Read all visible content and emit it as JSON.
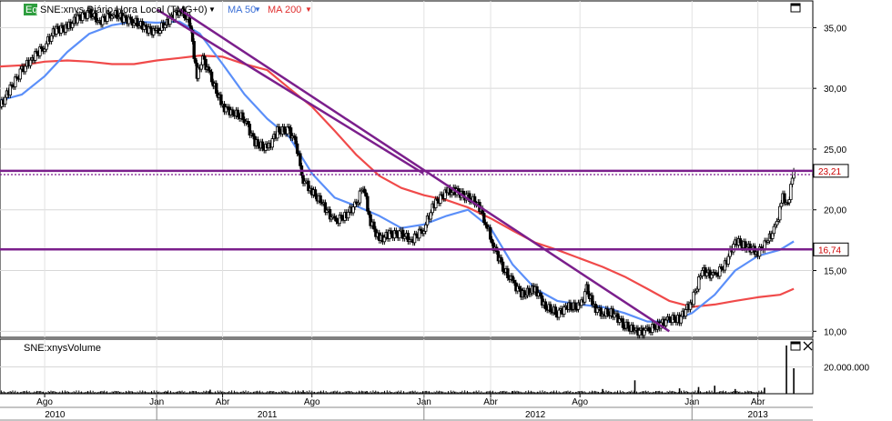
{
  "header": {
    "eq_badge": "Eq",
    "title": "SNE:xnys Diário Hora Local (TMG+0)",
    "ma50_label": "MA 50",
    "ma200_label": "MA 200"
  },
  "volume_panel": {
    "title": "SNE:xnysVolume"
  },
  "colors": {
    "price": "#000000",
    "ma50": "#5b8ff9",
    "ma200": "#f04a4a",
    "trendline": "#7b1f8c",
    "eq_badge": "#2e9e3e"
  },
  "icons": [
    "maximize-icon",
    "maximize-icon",
    "close-icon"
  ],
  "chart_data": [
    {
      "type": "line",
      "title": "SNE:xnys Diário Hora Local (TMG+0)",
      "ylim": [
        9.5,
        37.2
      ],
      "y_ticks": [
        "35,00",
        "30,00",
        "25,00",
        "20,00",
        "15,00",
        "10,00"
      ],
      "y_tick_values": [
        35,
        30,
        25,
        20,
        15,
        10
      ],
      "x_tick_labels": [
        "Ago",
        "Jan",
        "Abr",
        "Ago",
        "Jan",
        "Abr",
        "Ago",
        "Jan",
        "Abr"
      ],
      "x_tick_dates": [
        "2010-08-01",
        "2011-01-01",
        "2011-04-01",
        "2011-08-01",
        "2012-01-01",
        "2012-04-01",
        "2012-08-01",
        "2013-01-01",
        "2013-04-01"
      ],
      "year_labels": [
        "2010",
        "2011",
        "2012",
        "2013"
      ],
      "year_label_dates": [
        "2010-08-15",
        "2011-06-01",
        "2012-06-01",
        "2013-04-01"
      ],
      "year_boundaries": [
        "2011-01-01",
        "2012-01-01",
        "2013-01-01"
      ],
      "x_range": [
        "2010-06-01",
        "2013-06-15"
      ],
      "grid": true,
      "series": [
        {
          "name": "SNE:xnys",
          "points": [
            [
              "2010-06-01",
              28.5
            ],
            [
              "2010-06-15",
              30.0
            ],
            [
              "2010-07-01",
              31.5
            ],
            [
              "2010-07-15",
              32.5
            ],
            [
              "2010-08-01",
              33.5
            ],
            [
              "2010-08-15",
              34.8
            ],
            [
              "2010-09-01",
              35.0
            ],
            [
              "2010-09-15",
              35.8
            ],
            [
              "2010-10-01",
              36.2
            ],
            [
              "2010-10-15",
              35.5
            ],
            [
              "2010-11-01",
              36.2
            ],
            [
              "2010-11-15",
              35.8
            ],
            [
              "2010-12-01",
              35.5
            ],
            [
              "2010-12-15",
              35.0
            ],
            [
              "2011-01-01",
              34.6
            ],
            [
              "2011-01-15",
              35.5
            ],
            [
              "2011-02-01",
              36.5
            ],
            [
              "2011-02-15",
              35.5
            ],
            [
              "2011-02-25",
              31.0
            ],
            [
              "2011-03-05",
              32.5
            ],
            [
              "2011-03-15",
              31.0
            ],
            [
              "2011-04-01",
              28.5
            ],
            [
              "2011-04-15",
              28.0
            ],
            [
              "2011-05-01",
              27.5
            ],
            [
              "2011-05-15",
              25.5
            ],
            [
              "2011-06-01",
              25.0
            ],
            [
              "2011-06-15",
              26.5
            ],
            [
              "2011-07-01",
              26.5
            ],
            [
              "2011-07-10",
              25.5
            ],
            [
              "2011-07-20",
              22.5
            ],
            [
              "2011-08-01",
              21.5
            ],
            [
              "2011-08-15",
              20.5
            ],
            [
              "2011-09-01",
              19.0
            ],
            [
              "2011-09-15",
              19.5
            ],
            [
              "2011-10-01",
              20.5
            ],
            [
              "2011-10-10",
              22.0
            ],
            [
              "2011-10-20",
              19.0
            ],
            [
              "2011-11-01",
              17.5
            ],
            [
              "2011-11-15",
              18.0
            ],
            [
              "2011-12-01",
              18.0
            ],
            [
              "2011-12-15",
              17.5
            ],
            [
              "2012-01-01",
              18.5
            ],
            [
              "2012-01-15",
              20.5
            ],
            [
              "2012-02-01",
              21.5
            ],
            [
              "2012-02-15",
              21.5
            ],
            [
              "2012-03-01",
              21.0
            ],
            [
              "2012-03-15",
              20.5
            ],
            [
              "2012-03-25",
              19.0
            ],
            [
              "2012-04-05",
              17.0
            ],
            [
              "2012-04-20",
              15.0
            ],
            [
              "2012-05-01",
              14.0
            ],
            [
              "2012-05-15",
              13.0
            ],
            [
              "2012-06-01",
              13.5
            ],
            [
              "2012-06-15",
              12.0
            ],
            [
              "2012-07-01",
              11.5
            ],
            [
              "2012-07-15",
              12.0
            ],
            [
              "2012-08-01",
              12.0
            ],
            [
              "2012-08-10",
              13.5
            ],
            [
              "2012-08-20",
              12.0
            ],
            [
              "2012-09-01",
              11.5
            ],
            [
              "2012-09-15",
              11.5
            ],
            [
              "2012-10-01",
              10.5
            ],
            [
              "2012-10-15",
              10.0
            ],
            [
              "2012-11-01",
              10.0
            ],
            [
              "2012-11-15",
              10.5
            ],
            [
              "2012-12-01",
              11.0
            ],
            [
              "2012-12-15",
              11.0
            ],
            [
              "2013-01-01",
              12.5
            ],
            [
              "2013-01-15",
              15.0
            ],
            [
              "2013-02-01",
              14.5
            ],
            [
              "2013-02-15",
              15.5
            ],
            [
              "2013-03-01",
              17.5
            ],
            [
              "2013-03-15",
              17.0
            ],
            [
              "2013-04-01",
              16.5
            ],
            [
              "2013-04-15",
              17.5
            ],
            [
              "2013-04-25",
              18.5
            ],
            [
              "2013-05-05",
              21.0
            ],
            [
              "2013-05-12",
              20.5
            ],
            [
              "2013-05-20",
              23.2
            ]
          ]
        },
        {
          "name": "MA 50",
          "points": [
            [
              "2010-06-01",
              29.0
            ],
            [
              "2010-07-01",
              29.5
            ],
            [
              "2010-08-01",
              31.0
            ],
            [
              "2010-09-01",
              33.0
            ],
            [
              "2010-10-01",
              34.5
            ],
            [
              "2010-11-01",
              35.2
            ],
            [
              "2010-12-01",
              35.5
            ],
            [
              "2011-01-01",
              35.4
            ],
            [
              "2011-02-01",
              35.5
            ],
            [
              "2011-03-01",
              34.5
            ],
            [
              "2011-04-01",
              32.0
            ],
            [
              "2011-05-01",
              29.5
            ],
            [
              "2011-06-01",
              27.5
            ],
            [
              "2011-07-01",
              26.0
            ],
            [
              "2011-08-01",
              23.0
            ],
            [
              "2011-09-01",
              21.0
            ],
            [
              "2011-10-01",
              20.3
            ],
            [
              "2011-11-01",
              19.5
            ],
            [
              "2011-12-01",
              18.5
            ],
            [
              "2012-01-01",
              18.8
            ],
            [
              "2012-02-01",
              19.5
            ],
            [
              "2012-03-01",
              20.0
            ],
            [
              "2012-04-01",
              18.5
            ],
            [
              "2012-05-01",
              15.5
            ],
            [
              "2012-06-01",
              13.5
            ],
            [
              "2012-07-01",
              12.5
            ],
            [
              "2012-08-01",
              12.2
            ],
            [
              "2012-09-01",
              12.0
            ],
            [
              "2012-10-01",
              11.5
            ],
            [
              "2012-11-01",
              10.8
            ],
            [
              "2012-12-01",
              10.8
            ],
            [
              "2013-01-01",
              11.5
            ],
            [
              "2013-02-01",
              13.0
            ],
            [
              "2013-03-01",
              15.0
            ],
            [
              "2013-04-01",
              16.2
            ],
            [
              "2013-05-01",
              16.7
            ],
            [
              "2013-05-20",
              17.4
            ]
          ]
        },
        {
          "name": "MA 200",
          "points": [
            [
              "2010-06-01",
              31.8
            ],
            [
              "2010-07-01",
              31.9
            ],
            [
              "2010-08-01",
              32.2
            ],
            [
              "2010-09-01",
              32.3
            ],
            [
              "2010-10-01",
              32.2
            ],
            [
              "2010-11-01",
              32.0
            ],
            [
              "2010-12-01",
              32.0
            ],
            [
              "2011-01-01",
              32.3
            ],
            [
              "2011-02-01",
              32.5
            ],
            [
              "2011-03-01",
              32.7
            ],
            [
              "2011-04-01",
              32.6
            ],
            [
              "2011-05-01",
              32.0
            ],
            [
              "2011-06-01",
              31.5
            ],
            [
              "2011-07-01",
              30.0
            ],
            [
              "2011-08-01",
              28.5
            ],
            [
              "2011-09-01",
              26.5
            ],
            [
              "2011-10-01",
              24.5
            ],
            [
              "2011-11-01",
              22.8
            ],
            [
              "2011-12-01",
              21.8
            ],
            [
              "2012-01-01",
              21.2
            ],
            [
              "2012-02-01",
              20.8
            ],
            [
              "2012-03-01",
              20.2
            ],
            [
              "2012-04-01",
              19.3
            ],
            [
              "2012-05-01",
              18.3
            ],
            [
              "2012-06-01",
              17.3
            ],
            [
              "2012-07-01",
              16.7
            ],
            [
              "2012-08-01",
              16.0
            ],
            [
              "2012-09-01",
              15.3
            ],
            [
              "2012-10-01",
              14.5
            ],
            [
              "2012-11-01",
              13.5
            ],
            [
              "2012-12-01",
              12.5
            ],
            [
              "2013-01-01",
              12.0
            ],
            [
              "2013-02-01",
              12.2
            ],
            [
              "2013-03-01",
              12.5
            ],
            [
              "2013-04-01",
              12.8
            ],
            [
              "2013-05-01",
              13.0
            ],
            [
              "2013-05-20",
              13.5
            ]
          ]
        }
      ],
      "horizontal_lines": [
        {
          "value": 23.21,
          "label": "23,21"
        },
        {
          "value": 16.74,
          "label": "16,74"
        }
      ],
      "trendlines": [
        {
          "from": [
            "2011-02-01",
            36.5
          ],
          "to": [
            "2012-12-01",
            10.0
          ]
        },
        {
          "from": [
            "2011-01-01",
            36.5
          ],
          "to": [
            "2011-12-31",
            23.0
          ]
        }
      ],
      "dotted_line": {
        "value": 22.9
      }
    },
    {
      "type": "bar",
      "title": "SNE:xnysVolume",
      "y_ticks": [
        "20.000.000"
      ],
      "y_tick_values": [
        20000000
      ],
      "ylim": [
        0,
        38000000
      ],
      "series": [
        {
          "name": "Volume",
          "points": [
            [
              "2011-01-15",
              1500000
            ],
            [
              "2011-03-15",
              3000000
            ],
            [
              "2011-07-20",
              2500000
            ],
            [
              "2011-10-15",
              2000000
            ],
            [
              "2012-05-01",
              2000000
            ],
            [
              "2012-09-01",
              3500000
            ],
            [
              "2012-10-15",
              10000000
            ],
            [
              "2012-12-15",
              4000000
            ],
            [
              "2013-01-10",
              5000000
            ],
            [
              "2013-02-01",
              6000000
            ],
            [
              "2013-03-01",
              3500000
            ],
            [
              "2013-04-10",
              4500000
            ],
            [
              "2013-05-10",
              36000000
            ],
            [
              "2013-05-20",
              19000000
            ]
          ]
        }
      ]
    }
  ]
}
